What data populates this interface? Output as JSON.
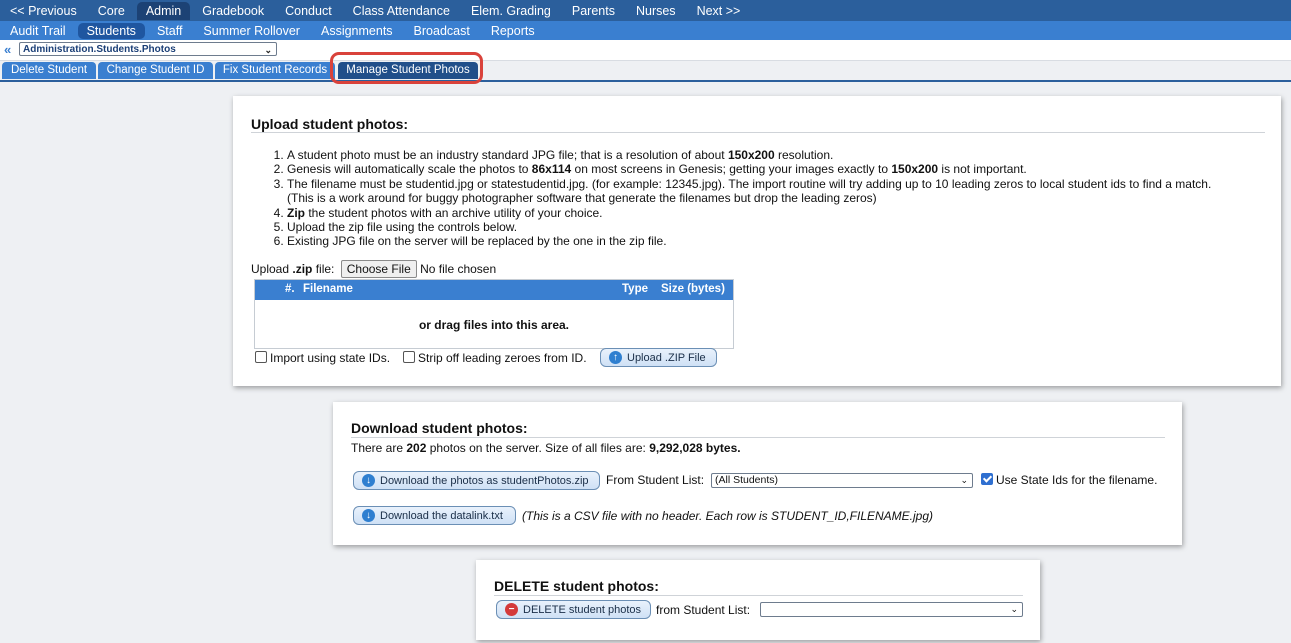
{
  "nav_top": [
    "<< Previous",
    "Core",
    "Admin",
    "Gradebook",
    "Conduct",
    "Class Attendance",
    "Elem. Grading",
    "Parents",
    "Nurses",
    "Next >>"
  ],
  "nav_top_active": "Admin",
  "nav_sub": [
    "Audit Trail",
    "Students",
    "Staff",
    "Summer Rollover",
    "Assignments",
    "Broadcast",
    "Reports"
  ],
  "nav_sub_active": "Students",
  "breadcrumb": "Administration.Students.Photos",
  "subtabs": [
    "Delete Student",
    "Change Student ID",
    "Fix Student Records",
    "Manage Student Photos"
  ],
  "subtab_active": "Manage Student Photos",
  "upload": {
    "title": "Upload student photos:",
    "steps": [
      {
        "pre": "A student photo must be an industry standard JPG file; that is a resolution of about ",
        "b": "150x200",
        "post": " resolution."
      },
      {
        "pre": "Genesis will automatically scale the photos to ",
        "b": "86x114",
        "post": " on most screens in Genesis; getting your images exactly to ",
        "b2": "150x200",
        "post2": " is not important."
      },
      {
        "pre": "The filename must be studentid.jpg or statestudentid.jpg. (for example: 12345.jpg). The import routine will try adding up to 10 leading zeros to local student ids to find a match.",
        "line2": "(This is a work around for buggy photographer software that generate the filenames but drop the leading zeros)"
      },
      {
        "b": "Zip",
        "post": " the student photos with an archive utility of your choice."
      },
      {
        "pre": "Upload the zip file using the controls below."
      },
      {
        "pre": "Existing JPG file on the server will be replaced by the one in the zip file."
      }
    ],
    "upload_label_pre": "Upload ",
    "upload_label_b": ".zip",
    "upload_label_post": " file:",
    "choose_file": "Choose File",
    "no_file": "No file chosen",
    "grid_headers": {
      "num": "#.",
      "filename": "Filename",
      "type": "Type",
      "size": "Size (bytes)"
    },
    "drop_text": "or drag files into this area.",
    "import_state_ids": "Import using state IDs.",
    "strip_zeroes": "Strip off leading zeroes from ID.",
    "upload_button": "Upload .ZIP File"
  },
  "download": {
    "title": "Download student photos:",
    "info_pre": "There are ",
    "count": "202",
    "info_mid": " photos on the server. Size of all files are: ",
    "size": "9,292,028 bytes.",
    "zip_button": "Download the photos as studentPhotos.zip",
    "from_list_label": "From Student List:",
    "student_list": "(All Students)",
    "use_state_ids": "Use State Ids for the filename.",
    "datalink_button": "Download the datalink.txt",
    "datalink_note": "(This is a CSV file with no header. Each row is STUDENT_ID,FILENAME.jpg)"
  },
  "delete": {
    "title": "DELETE student photos:",
    "button": "DELETE student photos",
    "from_list_label": "from Student List:",
    "student_list": ""
  },
  "colors": {
    "nav_dark": "#2b5f9c",
    "nav_light": "#3a7fd0",
    "highlight": "#d9423b"
  }
}
